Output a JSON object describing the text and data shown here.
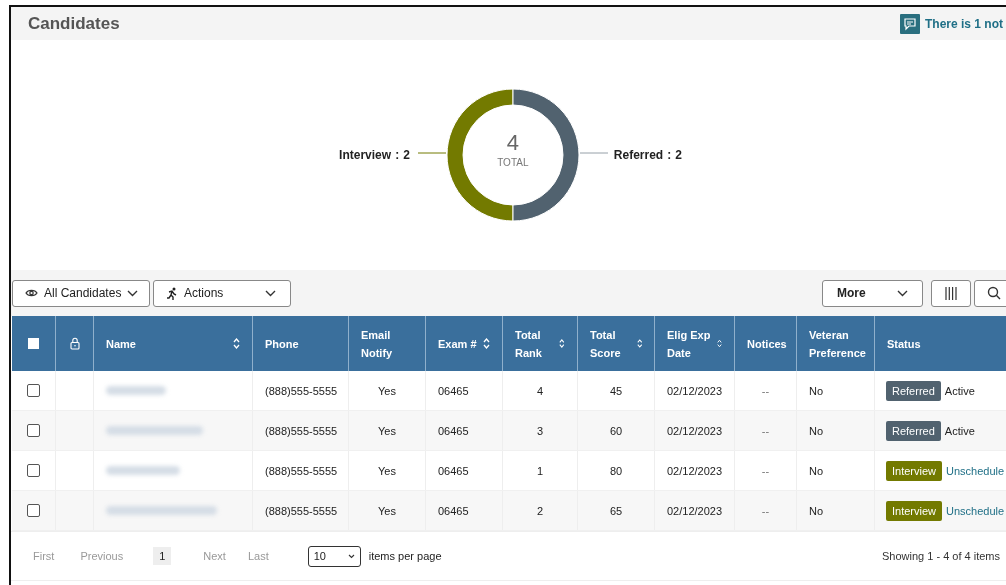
{
  "page_title": "Candidates",
  "notice": {
    "text": "There is 1 not"
  },
  "summary": {
    "total": "4",
    "total_label": "TOTAL",
    "label_separators": [
      ":",
      ":"
    ],
    "chart_data": {
      "type": "donut",
      "categories": [
        "Interview",
        "Referred"
      ],
      "values": [
        2,
        2
      ],
      "colors": [
        "#737a00",
        "#51626f"
      ],
      "data_labels": true
    }
  },
  "toolbar": {
    "filter": "All Candidates",
    "actions": "Actions",
    "more": "More"
  },
  "table": {
    "header_checked": false,
    "columns": [
      {
        "label": "Name",
        "sortable": true
      },
      {
        "label": "Phone",
        "sortable": false
      },
      {
        "label": "Email Notify",
        "sortable": false
      },
      {
        "label": "Exam #",
        "sortable": true
      },
      {
        "label": "Total Rank",
        "sortable": true
      },
      {
        "label": "Total Score",
        "sortable": true
      },
      {
        "label": "Elig Exp Date",
        "sortable": true
      },
      {
        "label": "Notices",
        "sortable": false
      },
      {
        "label": "Veteran Preference",
        "sortable": false
      },
      {
        "label": "Status",
        "sortable": false
      }
    ],
    "rows": [
      {
        "checked": false,
        "phone": "(888)555-5555",
        "email": "Yes",
        "exam": "06465",
        "rank": "4",
        "score": "45",
        "elig": "02/12/2023",
        "notices": "--",
        "veteran": "No",
        "status": {
          "label": "Referred",
          "kind": "referred"
        },
        "note": {
          "text": "Active",
          "link": false
        }
      },
      {
        "checked": false,
        "phone": "(888)555-5555",
        "email": "Yes",
        "exam": "06465",
        "rank": "3",
        "score": "60",
        "elig": "02/12/2023",
        "notices": "--",
        "veteran": "No",
        "status": {
          "label": "Referred",
          "kind": "referred"
        },
        "note": {
          "text": "Active",
          "link": false
        }
      },
      {
        "checked": false,
        "phone": "(888)555-5555",
        "email": "Yes",
        "exam": "06465",
        "rank": "1",
        "score": "80",
        "elig": "02/12/2023",
        "notices": "--",
        "veteran": "No",
        "status": {
          "label": "Interview",
          "kind": "interview"
        },
        "note": {
          "text": "Unschedule",
          "link": true
        }
      },
      {
        "checked": false,
        "phone": "(888)555-5555",
        "email": "Yes",
        "exam": "06465",
        "rank": "2",
        "score": "65",
        "elig": "02/12/2023",
        "notices": "--",
        "veteran": "No",
        "status": {
          "label": "Interview",
          "kind": "interview"
        },
        "note": {
          "text": "Unschedule",
          "link": true
        }
      }
    ]
  },
  "pager": {
    "first": "First",
    "previous": "Previous",
    "pages": [
      {
        "label": "1",
        "selected": true
      }
    ],
    "next": "Next",
    "last": "Last",
    "per_page": "10",
    "per_page_label": "items per page",
    "showing": "Showing 1 - 4 of 4 items"
  }
}
